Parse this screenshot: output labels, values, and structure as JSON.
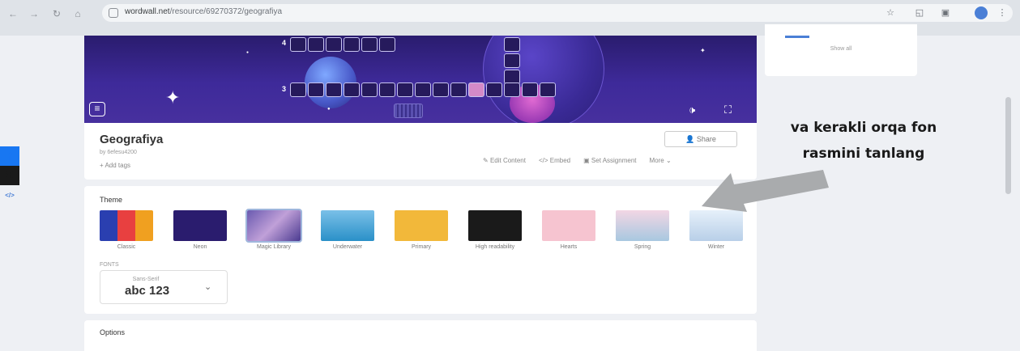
{
  "browser": {
    "url_host": "wordwall.net",
    "url_path": "/resource/69270372/geografiya"
  },
  "social": [
    {
      "name": "facebook-icon",
      "glyph": "f",
      "color": "#1877f2"
    },
    {
      "name": "x-icon",
      "glyph": "✕",
      "color": "#1a1a1a"
    },
    {
      "name": "embed-icon",
      "glyph": "</>",
      "color": "#ffffff"
    }
  ],
  "game": {
    "row_numbers": [
      "4",
      "3"
    ],
    "sound_icon": "🕩",
    "fullscreen_icon": "⛶"
  },
  "activity": {
    "title": "Geografiya",
    "author": "by 6efesu4200",
    "add_tags": "+ Add tags",
    "share": "Share",
    "actions": {
      "edit": "Edit Content",
      "embed": "Embed",
      "assign": "Set Assignment",
      "more": "More"
    }
  },
  "theme": {
    "heading": "Theme",
    "selected": "Magic Library",
    "items": [
      {
        "label": "Classic"
      },
      {
        "label": "Neon"
      },
      {
        "label": "Magic Library"
      },
      {
        "label": "Underwater"
      },
      {
        "label": "Primary"
      },
      {
        "label": "High readability"
      },
      {
        "label": "Hearts"
      },
      {
        "label": "Spring"
      },
      {
        "label": "Winter"
      }
    ],
    "fonts_label": "FONTS",
    "font_style": "Sans-Serif",
    "font_sample": "abc 123"
  },
  "options": {
    "heading": "Options"
  },
  "sidebar": {
    "show_all": "Show all"
  },
  "annotation": {
    "line1": "va kerakli orqa fon",
    "line2": "rasmini tanlang",
    "arrow_color": "#a9abad"
  }
}
